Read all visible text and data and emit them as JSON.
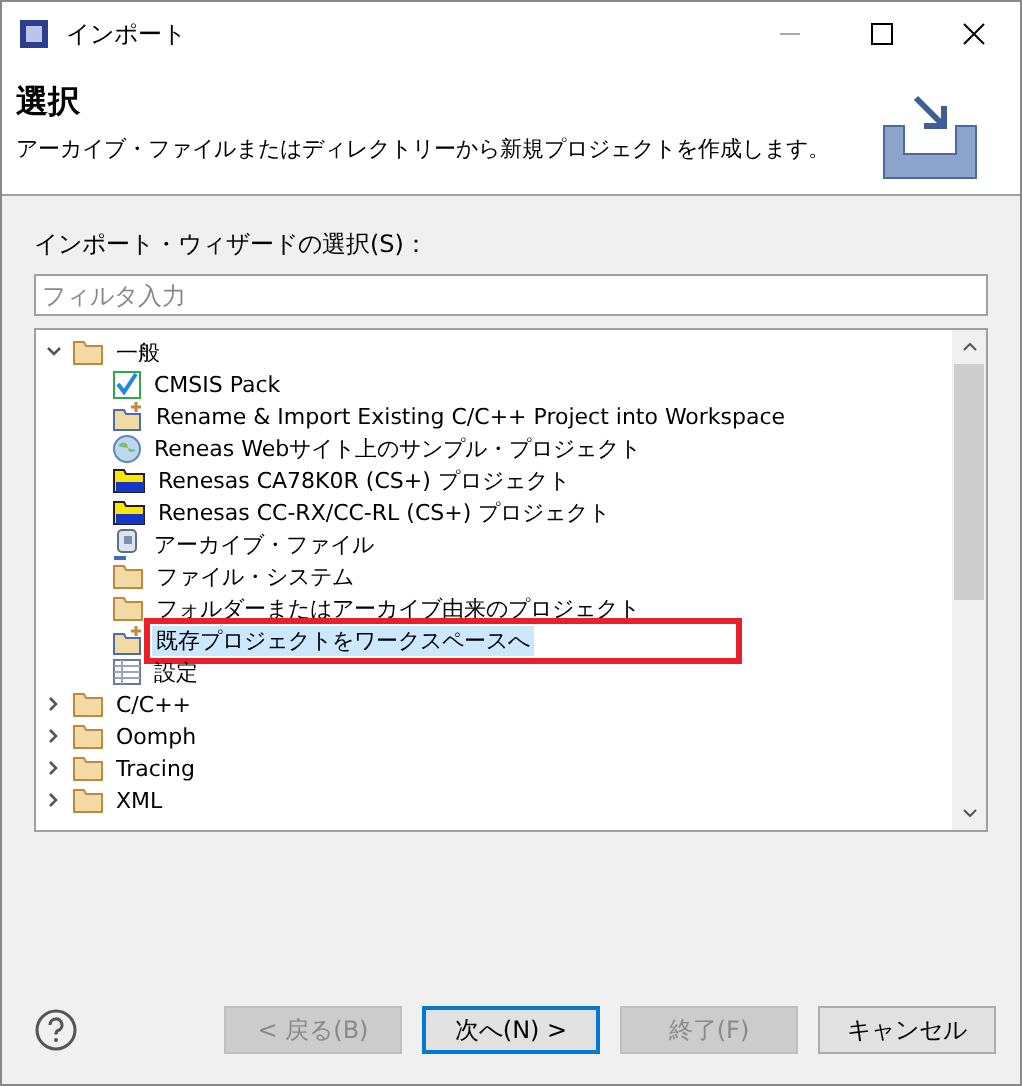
{
  "window": {
    "title": "インポート"
  },
  "header": {
    "title": "選択",
    "description": "アーカイブ・ファイルまたはディレクトリーから新規プロジェクトを作成します。"
  },
  "wizard_label": "インポート・ウィザードの選択(S)：",
  "filter": {
    "placeholder": "フィルタ入力"
  },
  "tree": [
    {
      "label": "一般",
      "kind": "category",
      "expanded": true,
      "selected": false,
      "callout": false,
      "children": [
        {
          "label": "CMSIS Pack",
          "kind": "pack",
          "selected": false,
          "callout": false
        },
        {
          "label": "Rename & Import Existing C/C++ Project into Workspace",
          "kind": "import",
          "selected": false,
          "callout": false
        },
        {
          "label": "Reneas Webサイト上のサンプル・プロジェクト",
          "kind": "web",
          "selected": false,
          "callout": false
        },
        {
          "label": "Renesas CA78K0R (CS+) プロジェクト",
          "kind": "renesas",
          "selected": false,
          "callout": false
        },
        {
          "label": "Renesas CC-RX/CC-RL (CS+) プロジェクト",
          "kind": "renesas",
          "selected": false,
          "callout": false
        },
        {
          "label": "アーカイブ・ファイル",
          "kind": "archive",
          "selected": false,
          "callout": false
        },
        {
          "label": "ファイル・システム",
          "kind": "filesystem",
          "selected": false,
          "callout": false
        },
        {
          "label": "フォルダーまたはアーカイブ由来のプロジェクト",
          "kind": "filesystem",
          "selected": false,
          "callout": false
        },
        {
          "label": "既存プロジェクトをワークスペースへ",
          "kind": "import",
          "selected": true,
          "callout": true
        },
        {
          "label": "設定",
          "kind": "preferences",
          "selected": false,
          "callout": false
        }
      ]
    },
    {
      "label": "C/C++",
      "kind": "category",
      "expanded": false,
      "selected": false,
      "callout": false
    },
    {
      "label": "Oomph",
      "kind": "category",
      "expanded": false,
      "selected": false,
      "callout": false
    },
    {
      "label": "Tracing",
      "kind": "category",
      "expanded": false,
      "selected": false,
      "callout": false
    },
    {
      "label": "XML",
      "kind": "category",
      "expanded": false,
      "selected": false,
      "callout": false
    }
  ],
  "buttons": [
    {
      "label": "< 戻る(B)",
      "disabled": true,
      "default": false
    },
    {
      "label": "次へ(N) >",
      "disabled": false,
      "default": true
    },
    {
      "label": "終了(F)",
      "disabled": true,
      "default": false
    },
    {
      "label": "キャンセル",
      "disabled": false,
      "default": false
    }
  ]
}
